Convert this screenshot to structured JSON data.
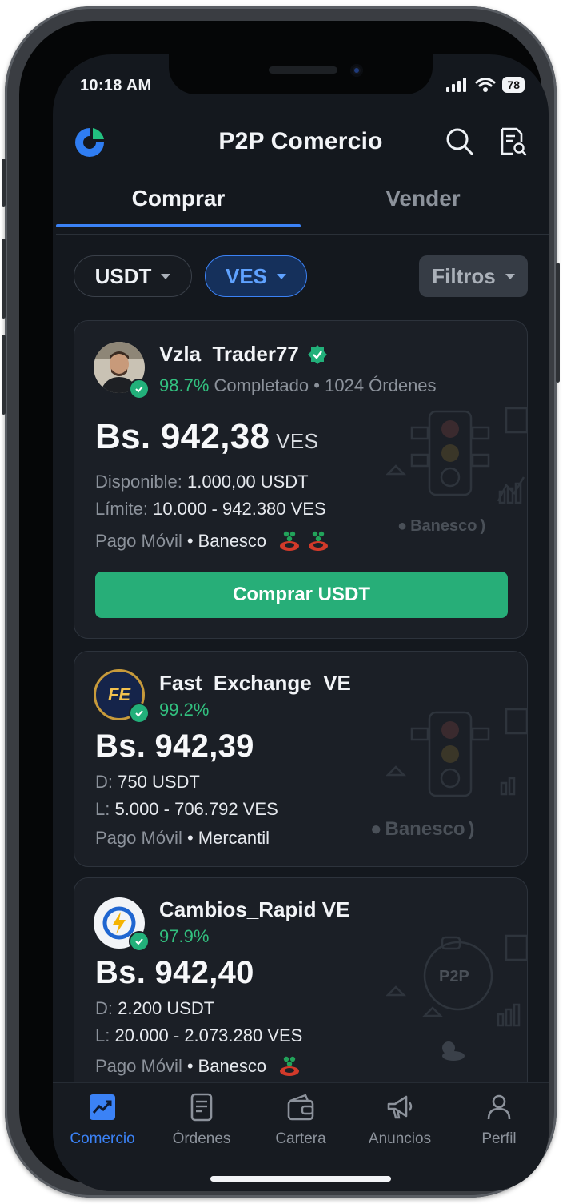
{
  "status_bar": {
    "time": "10:18 AM",
    "battery": "78"
  },
  "header": {
    "title": "P2P Comercio"
  },
  "tabs": [
    {
      "label": "Comprar",
      "active": true
    },
    {
      "label": "Vender",
      "active": false
    }
  ],
  "filters": {
    "asset": "USDT",
    "fiat": "VES",
    "filters_label": "Filtros"
  },
  "offers": [
    {
      "name": "Vzla_Trader77",
      "verified": true,
      "completion": "98.7%",
      "completion_label": "Completado",
      "separator": "•",
      "orders": "1024 Órdenes",
      "price": "Bs. 942,38",
      "price_currency": "VES",
      "available_label": "Disponible:",
      "available": "1.000,00 USDT",
      "limit_label": "Límite:",
      "limit": "10.000 - 942.380 VES",
      "payment_method": "Pago Móvil",
      "bank": "Banesco",
      "bg_bank_logo": "Banesco",
      "action_label": "Comprar USDT"
    },
    {
      "name": "Fast_Exchange_VE",
      "avatar_text": "FE",
      "completion": "99.2%",
      "price": "Bs. 942,39",
      "available_label": "D:",
      "available": "750 USDT",
      "limit_label": "L:",
      "limit": "5.000 - 706.792 VES",
      "payment_method": "Pago Móvil",
      "separator": "•",
      "bank": "Mercantil",
      "bg_bank_logo": "Banesco"
    },
    {
      "name": "Cambios_Rapid VE",
      "completion": "97.9%",
      "price": "Bs. 942,40",
      "available_label": "D:",
      "available": "2.200 USDT",
      "limit_label": "L:",
      "limit": "20.000 - 2.073.280 VES",
      "payment_method": "Pago Móvil",
      "separator": "•",
      "bank": "Banesco",
      "bg_art_text": "P2P"
    }
  ],
  "bottom_nav": [
    {
      "label": "Comercio",
      "icon": "chart-trend-icon",
      "active": true
    },
    {
      "label": "Órdenes",
      "icon": "document-icon",
      "active": false
    },
    {
      "label": "Cartera",
      "icon": "wallet-icon",
      "active": false
    },
    {
      "label": "Anuncios",
      "icon": "megaphone-icon",
      "active": false
    },
    {
      "label": "Perfil",
      "icon": "user-icon",
      "active": false
    }
  ],
  "colors": {
    "accent": "#3b82f6",
    "success": "#27ae78",
    "background": "#14181e",
    "card": "#1b1f26"
  }
}
